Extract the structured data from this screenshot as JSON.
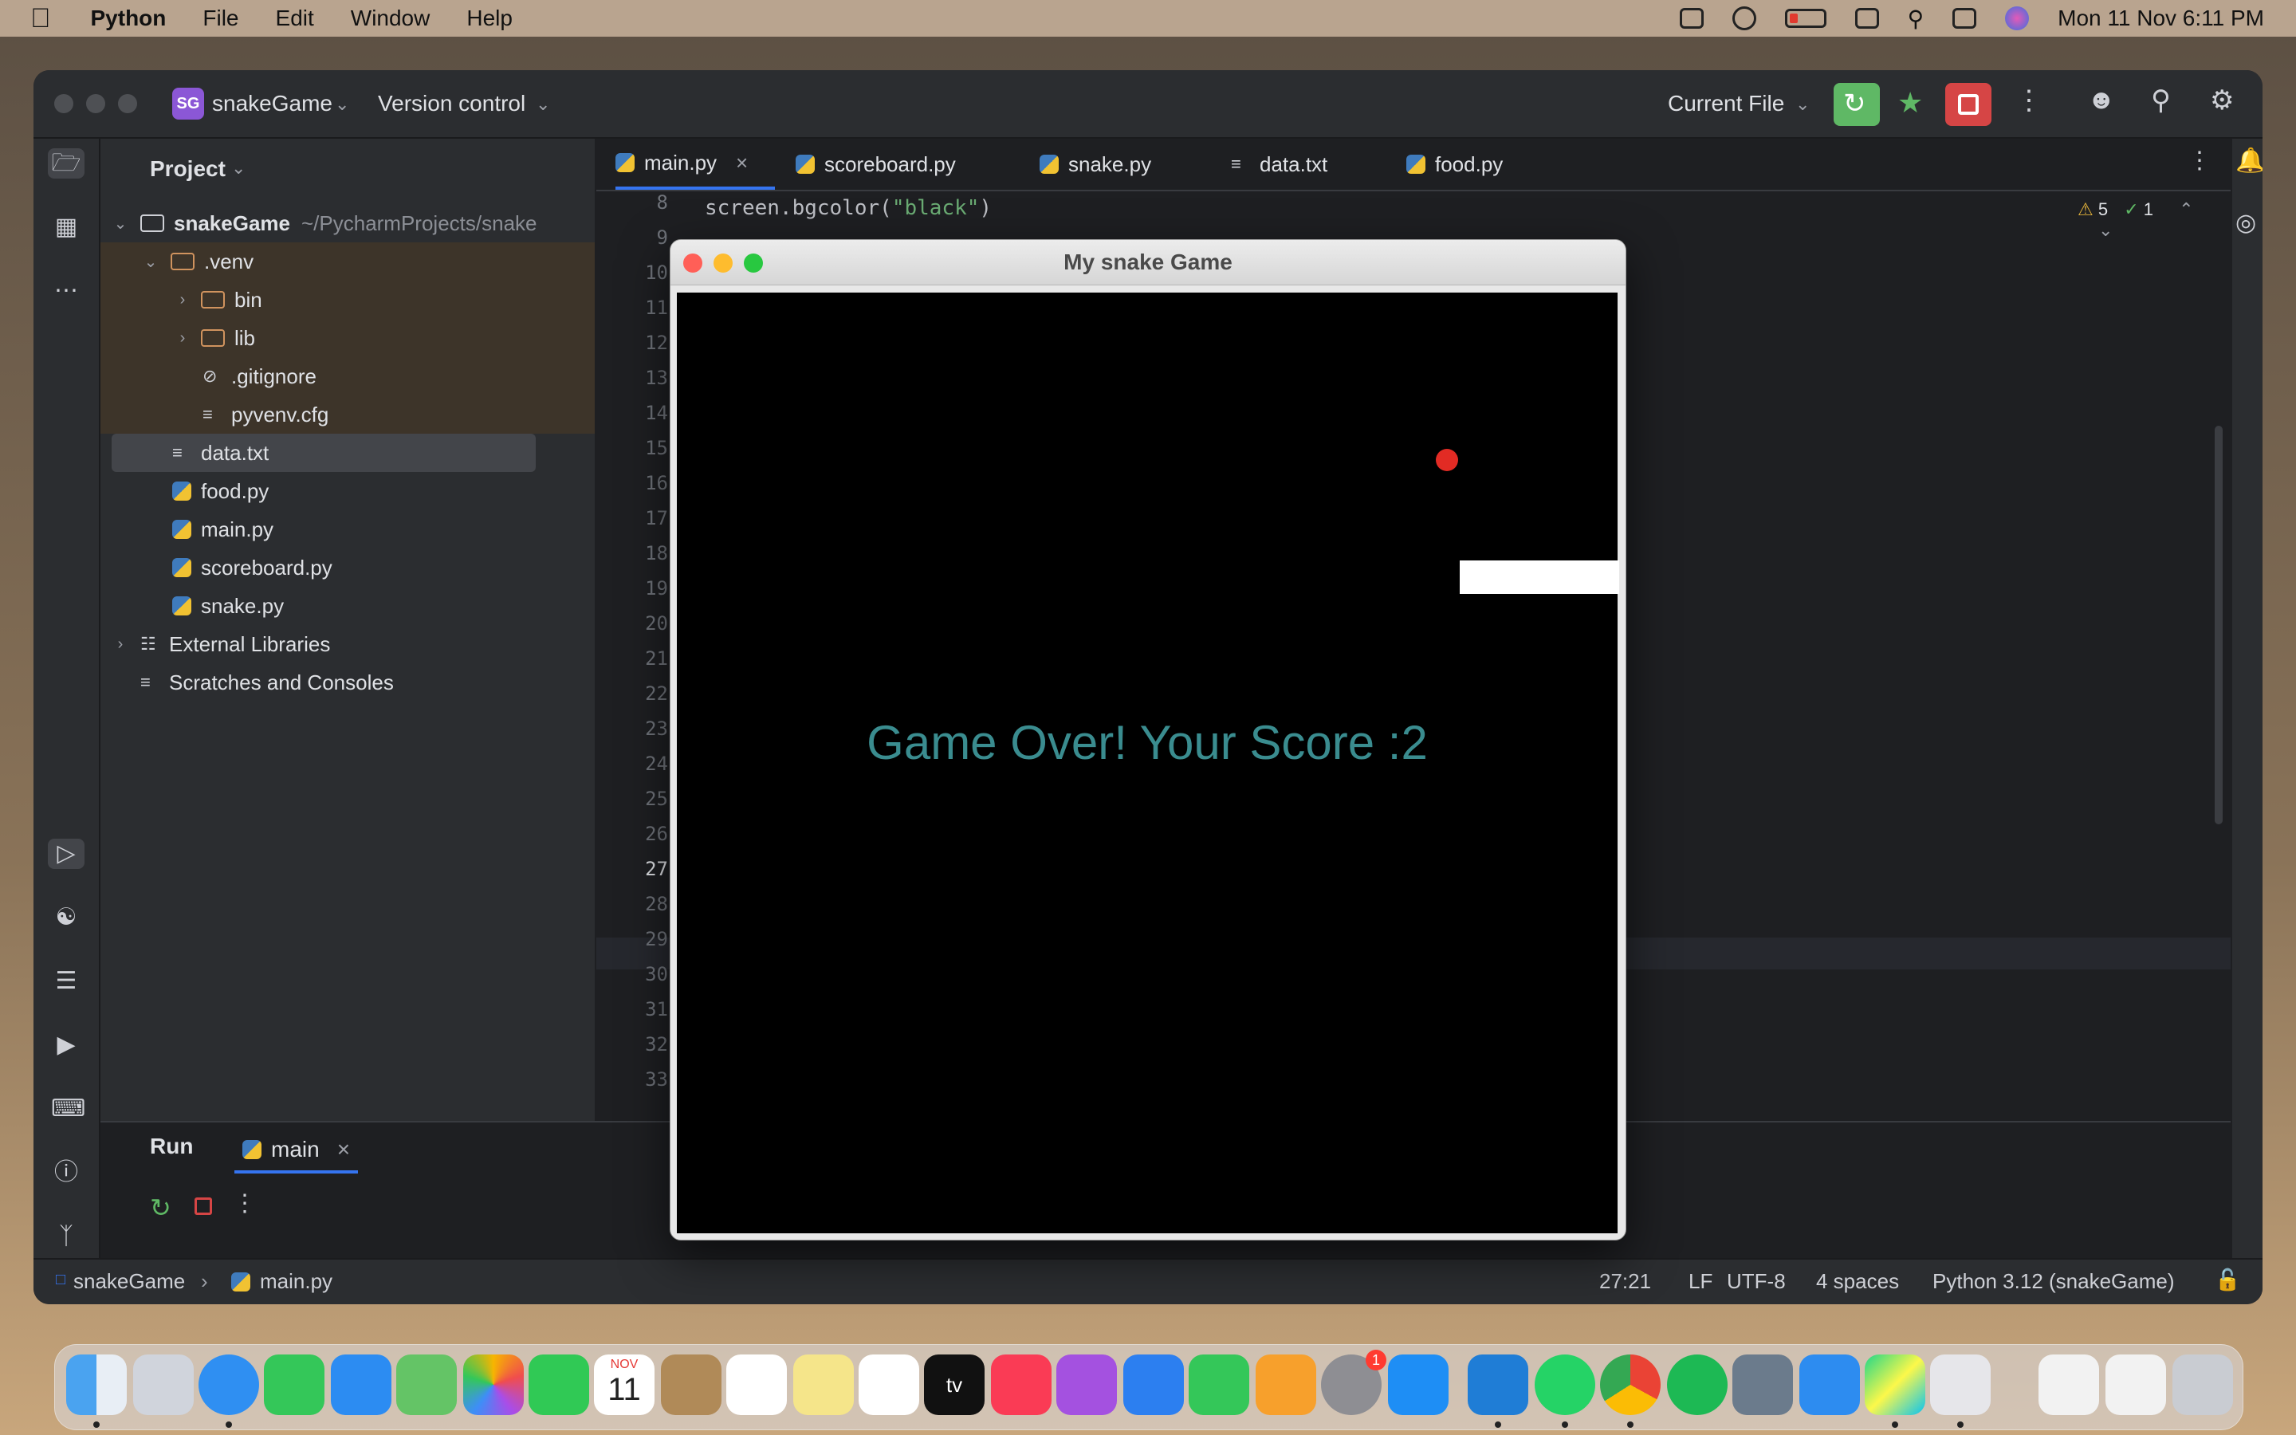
{
  "menubar": {
    "app_name": "Python",
    "items": [
      "File",
      "Edit",
      "Window",
      "Help"
    ],
    "clock": "Mon 11 Nov  6:11 PM"
  },
  "ide": {
    "project_badge": "SG",
    "project_name": "snakeGame",
    "vcs": "Version control",
    "run_config": "Current File",
    "colors": {
      "run": "#5fb865",
      "stop": "#d64545",
      "accent": "#3574f0"
    }
  },
  "project_panel": {
    "title": "Project",
    "root_name": "snakeGame",
    "root_path": "~/PycharmProjects/snake",
    "venv": ".venv",
    "bin": "bin",
    "lib": "lib",
    "gitignore": ".gitignore",
    "pyvenv": "pyvenv.cfg",
    "files": [
      "data.txt",
      "food.py",
      "main.py",
      "scoreboard.py",
      "snake.py"
    ],
    "external": "External Libraries",
    "scratches": "Scratches and Consoles"
  },
  "editor": {
    "tabs": [
      "main.py",
      "scoreboard.py",
      "snake.py",
      "data.txt",
      "food.py"
    ],
    "line_numbers": [
      "8",
      "9",
      "10",
      "11",
      "12",
      "13",
      "14",
      "15",
      "16",
      "17",
      "18",
      "19",
      "20",
      "21",
      "22",
      "23",
      "24",
      "25",
      "26",
      "27",
      "28",
      "29",
      "30",
      "31",
      "32",
      "33"
    ],
    "code_line_8_a": "screen.bgcolor(",
    "code_line_8_str": "\"black\"",
    "code_line_8_b": ")",
    "warnings": "5",
    "checks": "1"
  },
  "run_panel": {
    "label": "Run",
    "tab": "main"
  },
  "status": {
    "project": "snakeGame",
    "file": "main.py",
    "position": "27:21",
    "line_sep": "LF",
    "encoding": "UTF-8",
    "indent": "4 spaces",
    "interpreter": "Python 3.12 (snakeGame)"
  },
  "game": {
    "title": "My snake Game",
    "message": "Game Over! Your Score :2",
    "colors": {
      "background": "#000000",
      "food": "#e22b24",
      "snake": "#ffffff",
      "text": "#3a8c8f"
    }
  },
  "dock": {
    "calendar_month": "NOV",
    "calendar_day": "11",
    "settings_badge": "1"
  }
}
